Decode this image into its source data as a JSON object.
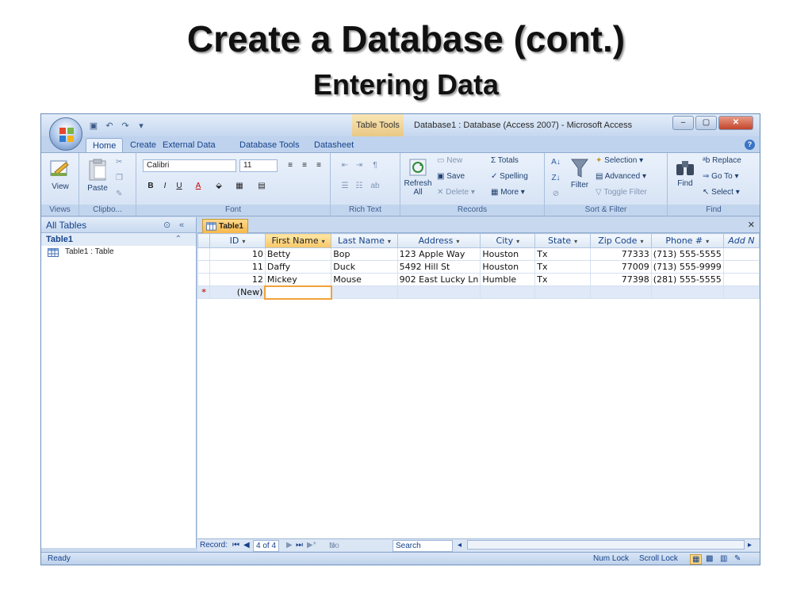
{
  "slide": {
    "title": "Create a Database (cont.)",
    "subtitle": "Entering Data"
  },
  "window": {
    "title": "Database1 : Database (Access 2007) - Microsoft Access",
    "context_tab": "Table Tools"
  },
  "tabs": [
    "Home",
    "Create",
    "External Data",
    "Database Tools",
    "Datasheet"
  ],
  "ribbon": {
    "views": {
      "label": "Views",
      "view": "View"
    },
    "clipboard": {
      "label": "Clipbo...",
      "paste": "Paste"
    },
    "font": {
      "label": "Font",
      "name": "Calibri",
      "size": "11"
    },
    "rich_text": {
      "label": "Rich Text"
    },
    "records": {
      "label": "Records",
      "refresh": "Refresh",
      "refresh2": "All",
      "new": "New",
      "save": "Save",
      "delete": "Delete",
      "totals": "Totals",
      "spelling": "Spelling",
      "more": "More"
    },
    "sort_filter": {
      "label": "Sort & Filter",
      "filter": "Filter",
      "selection": "Selection",
      "advanced": "Advanced",
      "toggle": "Toggle Filter"
    },
    "find": {
      "label": "Find",
      "find": "Find",
      "replace": "Replace",
      "goto": "Go To",
      "select": "Select"
    }
  },
  "nav_pane": {
    "header": "All Tables",
    "group": "Table1",
    "item": "Table1 : Table"
  },
  "document": {
    "tab": "Table1",
    "columns": [
      "ID",
      "First Name",
      "Last Name",
      "Address",
      "City",
      "State",
      "Zip Code",
      "Phone #",
      "Add N"
    ],
    "rows": [
      [
        "10",
        "Betty",
        "Bop",
        "123 Apple Way",
        "Houston",
        "Tx",
        "77333",
        "(713) 555-5555"
      ],
      [
        "11",
        "Daffy",
        "Duck",
        "5492 Hill St",
        "Houston",
        "Tx",
        "77009",
        "(713) 555-9999"
      ],
      [
        "12",
        "Mickey",
        "Mouse",
        "902 East Lucky Ln",
        "Humble",
        "Tx",
        "77398",
        "(281) 555-5555"
      ]
    ],
    "new_row_label": "(New)"
  },
  "record_bar": {
    "label": "Record:",
    "position": "4 of 4",
    "filter": "No Filter",
    "search": "Search"
  },
  "status": {
    "left": "Ready",
    "num_lock": "Num Lock",
    "scroll_lock": "Scroll Lock"
  }
}
